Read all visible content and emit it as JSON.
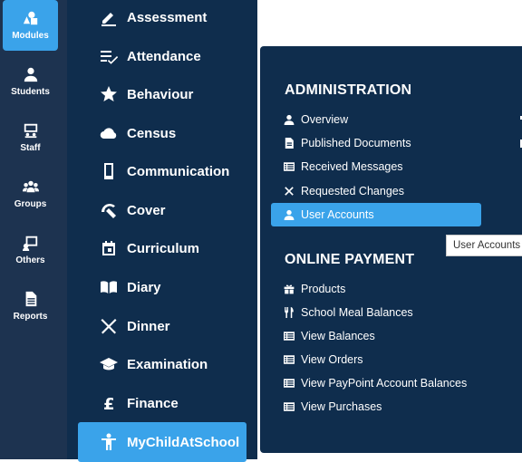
{
  "rail": [
    {
      "label": "Modules",
      "icon": "shapes-icon",
      "active": true
    },
    {
      "label": "Students",
      "icon": "person-icon"
    },
    {
      "label": "Staff",
      "icon": "staff-board-icon"
    },
    {
      "label": "Groups",
      "icon": "groups-icon"
    },
    {
      "label": "Others",
      "icon": "others-icon"
    },
    {
      "label": "Reports",
      "icon": "report-icon"
    }
  ],
  "modules": [
    {
      "label": "Assessment",
      "icon": "pencil-icon"
    },
    {
      "label": "Attendance",
      "icon": "checklist-icon"
    },
    {
      "label": "Behaviour",
      "icon": "star-icon"
    },
    {
      "label": "Census",
      "icon": "cloud-upload-icon"
    },
    {
      "label": "Communication",
      "icon": "phone-icon"
    },
    {
      "label": "Cover",
      "icon": "cover-icon"
    },
    {
      "label": "Curriculum",
      "icon": "calendar-icon"
    },
    {
      "label": "Diary",
      "icon": "book-icon"
    },
    {
      "label": "Dinner",
      "icon": "cutlery-icon"
    },
    {
      "label": "Examination",
      "icon": "graduation-cap-icon"
    },
    {
      "label": "Finance",
      "icon": "pound-icon"
    },
    {
      "label": "MyChildAtSchool",
      "icon": "child-icon",
      "active": true
    }
  ],
  "dropdown": {
    "administration": {
      "title": "ADMINISTRATION",
      "items": [
        {
          "label": "Overview",
          "icon": "person-icon"
        },
        {
          "label": "Published Documents",
          "icon": "document-icon"
        },
        {
          "label": "Received Messages",
          "icon": "list-icon"
        },
        {
          "label": "Requested Changes",
          "icon": "tools-icon"
        },
        {
          "label": "User Accounts",
          "icon": "person-icon",
          "active": true
        }
      ]
    },
    "online_payment": {
      "title": "ONLINE PAYMENT",
      "items": [
        {
          "label": "Products",
          "icon": "gift-icon"
        },
        {
          "label": "School Meal Balances",
          "icon": "cutlery-icon"
        },
        {
          "label": "View Balances",
          "icon": "list-icon"
        },
        {
          "label": "View Orders",
          "icon": "list-icon"
        },
        {
          "label": "View PayPoint Account Balances",
          "icon": "list-icon"
        },
        {
          "label": "View Purchases",
          "icon": "list-icon"
        }
      ]
    }
  },
  "tooltip": "User Accounts",
  "colors": {
    "rail": "#1d3350",
    "panel": "#0f2d4d",
    "accent": "#3aa3ea"
  }
}
